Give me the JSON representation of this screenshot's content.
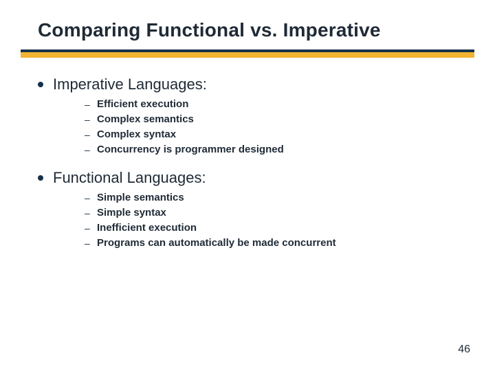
{
  "title": "Comparing Functional vs. Imperative",
  "sections": [
    {
      "heading": "Imperative Languages:",
      "items": [
        "Efficient execution",
        "Complex semantics",
        "Complex syntax",
        "Concurrency is programmer designed"
      ]
    },
    {
      "heading": "Functional Languages:",
      "items": [
        "Simple semantics",
        "Simple syntax",
        "Inefficient execution",
        "Programs can automatically be made concurrent"
      ]
    }
  ],
  "page_number": "46"
}
